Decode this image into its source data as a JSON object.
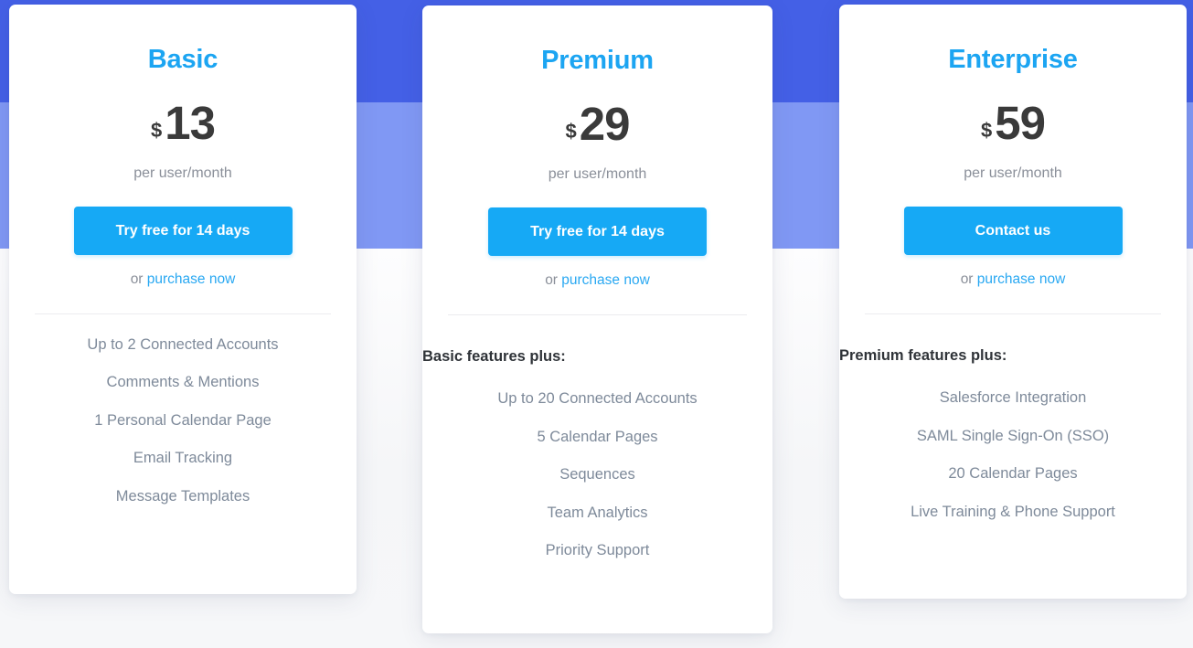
{
  "background": {
    "band_dark_color": "#4460e6",
    "band_mid_color": "#8098f4",
    "band_light_color": "#f6f7f9"
  },
  "theme": {
    "accent_blue": "#1ca5f2",
    "button_blue": "#16a9f5",
    "price_color": "#3a3a3a",
    "feature_color": "#7e8a9a",
    "muted_color": "#8a8f99"
  },
  "plans": [
    {
      "name": "Basic",
      "currency": "$",
      "amount": "13",
      "period": "per user/month",
      "cta_label": "Try free for 14 days",
      "or_text": "or ",
      "purchase_label": "purchase now",
      "features_heading": null,
      "features": [
        "Up to 2 Connected Accounts",
        "Comments & Mentions",
        "1 Personal Calendar Page",
        "Email Tracking",
        "Message Templates"
      ]
    },
    {
      "name": "Premium",
      "currency": "$",
      "amount": "29",
      "period": "per user/month",
      "cta_label": "Try free for 14 days",
      "or_text": "or ",
      "purchase_label": "purchase now",
      "features_heading": "Basic features plus:",
      "features": [
        "Up to 20 Connected Accounts",
        "5 Calendar Pages",
        "Sequences",
        "Team Analytics",
        "Priority Support"
      ]
    },
    {
      "name": "Enterprise",
      "currency": "$",
      "amount": "59",
      "period": "per user/month",
      "cta_label": "Contact us",
      "or_text": "or ",
      "purchase_label": "purchase now",
      "features_heading": "Premium features plus:",
      "features": [
        "Salesforce Integration",
        "SAML Single Sign-On (SSO)",
        "20 Calendar Pages",
        "Live Training & Phone Support"
      ]
    }
  ]
}
